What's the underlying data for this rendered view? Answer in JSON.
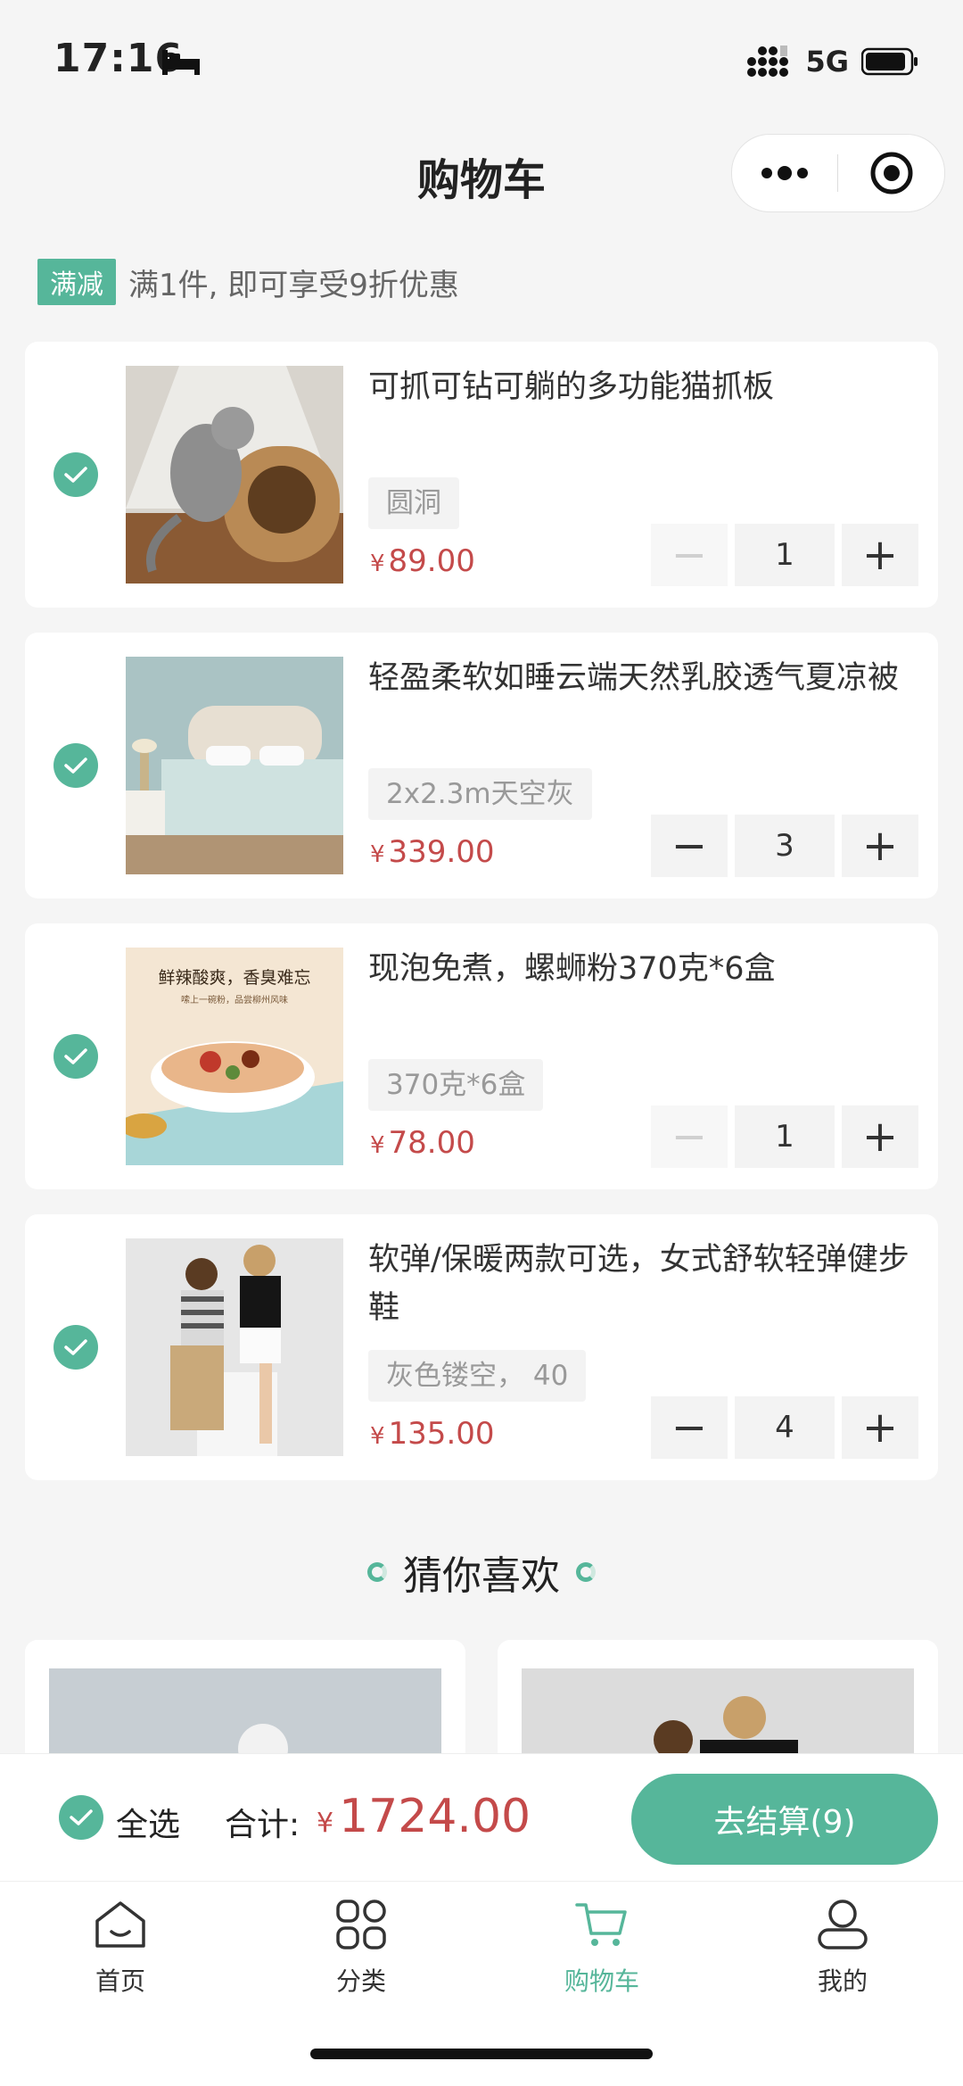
{
  "status_bar": {
    "time": "17:16",
    "network": "5G"
  },
  "nav": {
    "title": "购物车"
  },
  "promo": {
    "tag": "满减",
    "text": "满1件, 即可享受9折优惠"
  },
  "cart": {
    "items": [
      {
        "title": "可抓可钻可躺的多功能猫抓板",
        "sku": "圆洞",
        "currency": "¥",
        "price": "89.00",
        "qty": "1",
        "minus_disabled": true,
        "thumb": "cat-scratcher"
      },
      {
        "title": "轻盈柔软如睡云端天然乳胶透气夏凉被",
        "sku": "2x2.3m天空灰",
        "currency": "¥",
        "price": "339.00",
        "qty": "3",
        "minus_disabled": false,
        "thumb": "bedroom"
      },
      {
        "title": "现泡免煮，螺蛳粉370克*6盒",
        "sku": "370克*6盒",
        "currency": "¥",
        "price": "78.00",
        "qty": "1",
        "minus_disabled": true,
        "thumb": "noodle-bowl",
        "thumb_text1": "鲜辣酸爽，香臭难忘",
        "thumb_text2": "嗦上一碗粉，品尝柳州风味"
      },
      {
        "title": "软弹/保暖两款可选，女式舒软轻弹健步鞋",
        "sku": "灰色镂空， 40",
        "currency": "¥",
        "price": "135.00",
        "qty": "4",
        "minus_disabled": false,
        "thumb": "models"
      }
    ]
  },
  "recommend": {
    "title": "猜你喜欢"
  },
  "checkout": {
    "select_all_label": "全选",
    "total_label": "合计:",
    "currency": "¥",
    "total": "1724.00",
    "button_label": "去结算(9)"
  },
  "tabbar": {
    "items": [
      {
        "label": "首页",
        "icon": "home-icon"
      },
      {
        "label": "分类",
        "icon": "category-icon"
      },
      {
        "label": "购物车",
        "icon": "cart-icon",
        "active": true
      },
      {
        "label": "我的",
        "icon": "profile-icon"
      }
    ]
  },
  "colors": {
    "accent": "#56b69a",
    "price": "#c44a4a",
    "background": "#f5f5f5"
  }
}
